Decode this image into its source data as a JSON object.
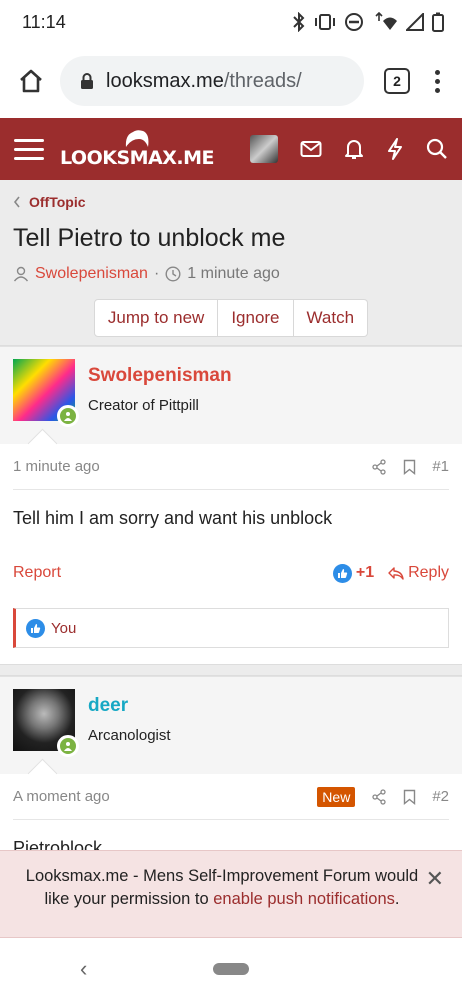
{
  "status_bar": {
    "time": "11:14"
  },
  "browser": {
    "url_host": "looksmax.me",
    "url_path": "/threads/",
    "tab_count": "2"
  },
  "site": {
    "logo_text": "LOOKSMAX.ME"
  },
  "breadcrumb": {
    "label": "OffTopic"
  },
  "thread": {
    "title": "Tell Pietro to unblock me",
    "author": "Swolepenisman",
    "separator": "·",
    "time": "1 minute ago",
    "buttons": {
      "jump": "Jump to new",
      "ignore": "Ignore",
      "watch": "Watch"
    }
  },
  "posts": [
    {
      "username": "Swolepenisman",
      "user_title": "Creator of Pittpill",
      "time": "1 minute ago",
      "number": "#1",
      "text": "Tell him I am sorry and want his unblock",
      "report": "Report",
      "likes": "+1",
      "reply": "Reply",
      "reactions_text": "You"
    },
    {
      "username": "deer",
      "user_title": "Arcanologist",
      "time": "A moment ago",
      "badge": "New",
      "number": "#2",
      "text": "Pietroblock"
    }
  ],
  "push_notice": {
    "text_before": "Looksmax.me - Mens Self-Improvement Forum would like your permission to",
    "link": "enable push notifications",
    "text_after": "."
  },
  "colors": {
    "brand": "#9b2d2d",
    "link_red": "#d9483b",
    "teal": "#17a8c4",
    "new_badge": "#d45500",
    "online": "#7cb342"
  }
}
